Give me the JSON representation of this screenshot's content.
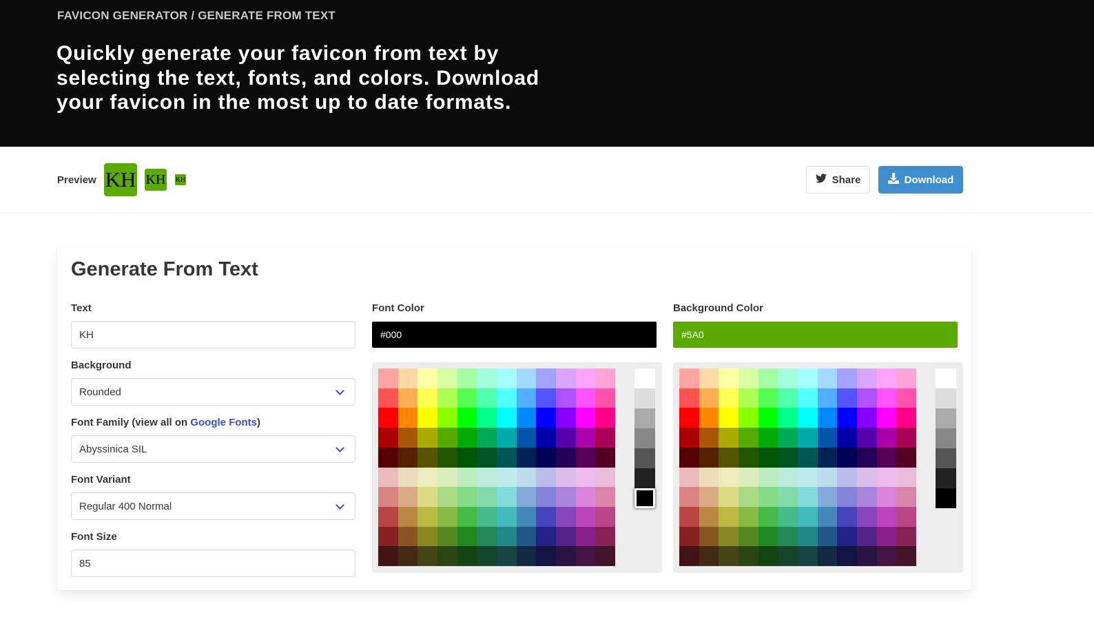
{
  "header": {
    "breadcrumb": "FAVICON GENERATOR / GENERATE FROM TEXT",
    "title": "Quickly generate your favicon from text by selecting the text, fonts, and colors. Download your favicon in the most up to date formats."
  },
  "preview": {
    "label": "Preview",
    "icon_text": "KH",
    "share_label": "Share",
    "download_label": "Download"
  },
  "form": {
    "title": "Generate From Text",
    "text_label": "Text",
    "text_value": "KH",
    "background_label": "Background",
    "background_value": "Rounded",
    "font_family_label_prefix": "Font Family (view all on ",
    "font_family_link": "Google Fonts",
    "font_family_label_suffix": ")",
    "font_family_value": "Abyssinica SIL",
    "font_variant_label": "Font Variant",
    "font_variant_value": "Regular 400 Normal",
    "font_size_label": "Font Size",
    "font_size_value": "85",
    "font_color_label": "Font Color",
    "font_color_value": "#000",
    "bg_color_label": "Background Color",
    "bg_color_value": "#5A0"
  },
  "colors": {
    "font_color": "#000000",
    "bg_color": "#5aaa00",
    "link": "#3850b7",
    "button_primary": "#3e8ed0"
  },
  "palette": {
    "rows": [
      [
        "#ffa3a3",
        "#ffd9a3",
        "#ffffa3",
        "#d9ffa3",
        "#a3ffa3",
        "#a3ffd9",
        "#a3ffff",
        "#a3d9ff",
        "#a3a3ff",
        "#d9a3ff",
        "#ffa3ff",
        "#ffa3d9"
      ],
      [
        "#ff5252",
        "#ffad52",
        "#ffff52",
        "#adff52",
        "#52ff52",
        "#52ffad",
        "#52ffff",
        "#52adff",
        "#5252ff",
        "#ad52ff",
        "#ff52ff",
        "#ff52ad"
      ],
      [
        "#ff0000",
        "#ff8800",
        "#ffff00",
        "#88ff00",
        "#00ff00",
        "#00ff88",
        "#00ffff",
        "#0088ff",
        "#0000ff",
        "#8800ff",
        "#ff00ff",
        "#ff0088"
      ],
      [
        "#aa0000",
        "#aa5500",
        "#aaaa00",
        "#55aa00",
        "#00aa00",
        "#00aa55",
        "#00aaaa",
        "#0055aa",
        "#0000aa",
        "#5500aa",
        "#aa00aa",
        "#aa0055"
      ],
      [
        "#550000",
        "#552200",
        "#555500",
        "#225500",
        "#005500",
        "#005522",
        "#005555",
        "#002255",
        "#000055",
        "#220055",
        "#550055",
        "#550022"
      ],
      [
        "#ebbcbc",
        "#ebdcbc",
        "#ebebbc",
        "#dcebbc",
        "#bcebbc",
        "#bcebdc",
        "#bcebeb",
        "#bcdceb",
        "#bcbceb",
        "#dcbceb",
        "#ebbceb",
        "#ebbcdc"
      ],
      [
        "#db8484",
        "#dbaa84",
        "#dbdb84",
        "#aadb84",
        "#84db84",
        "#84dbaa",
        "#84dbdb",
        "#84aadb",
        "#8484db",
        "#aa84db",
        "#db84db",
        "#db84aa"
      ],
      [
        "#bb4444",
        "#bb8844",
        "#bbbb44",
        "#88bb44",
        "#44bb44",
        "#44bb88",
        "#44bbbb",
        "#4488bb",
        "#4444bb",
        "#8844bb",
        "#bb44bb",
        "#bb4488"
      ],
      [
        "#882222",
        "#885522",
        "#888822",
        "#558822",
        "#228822",
        "#228855",
        "#228888",
        "#225588",
        "#222288",
        "#552288",
        "#882288",
        "#882255"
      ],
      [
        "#441414",
        "#442a14",
        "#444414",
        "#2a4414",
        "#144414",
        "#14442a",
        "#144444",
        "#142a44",
        "#141444",
        "#2a1444",
        "#441444",
        "#44142a"
      ]
    ],
    "grays": [
      "#ffffff",
      "#dddddd",
      "#aaaaaa",
      "#888888",
      "#555555",
      "#222222",
      "#000000"
    ]
  }
}
